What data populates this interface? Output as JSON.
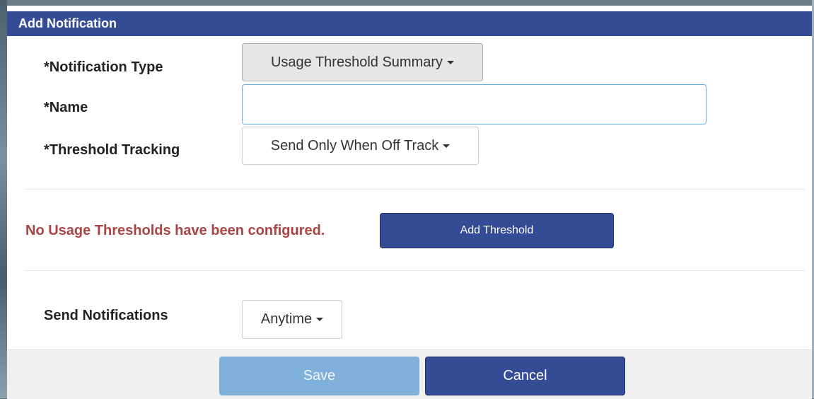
{
  "modal": {
    "title": "Add Notification"
  },
  "form": {
    "notification_type": {
      "label": "*Notification Type",
      "value": "Usage Threshold Summary"
    },
    "name": {
      "label": "*Name",
      "value": "",
      "placeholder": ""
    },
    "threshold_tracking": {
      "label": "*Threshold Tracking",
      "value": "Send Only When Off Track"
    },
    "thresholds": {
      "warning": "No Usage Thresholds have been configured.",
      "add_label": "Add Threshold"
    },
    "send_notifications": {
      "label": "Send Notifications",
      "value": "Anytime"
    }
  },
  "footer": {
    "save_label": "Save",
    "cancel_label": "Cancel"
  },
  "colors": {
    "header_bg": "#344c96",
    "warning": "#a94442",
    "save_disabled": "#7fb0d9"
  },
  "icons": {
    "dropdown": "caret-down-icon"
  }
}
